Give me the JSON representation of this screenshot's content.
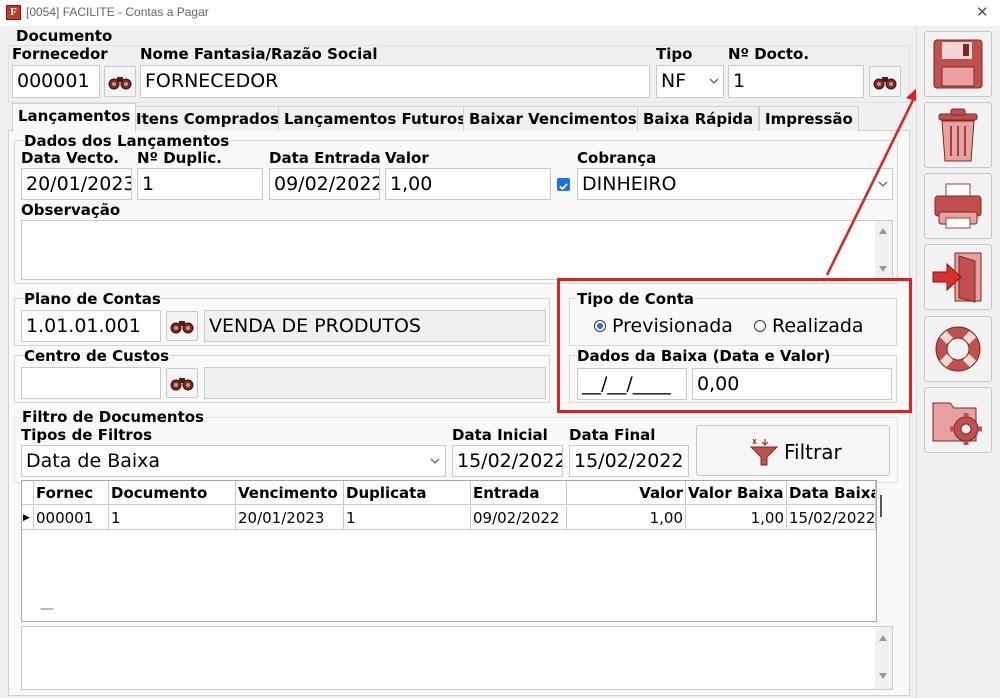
{
  "window": {
    "title": "[0054] FACILITE - Contas a Pagar",
    "app_icon_letter": "F",
    "close_glyph": "✕"
  },
  "header": {
    "section_title": "Documento",
    "fornecedor_label": "Fornecedor",
    "fornecedor_value": "000001",
    "nome_label": "Nome Fantasia/Razão Social",
    "nome_value": "FORNECEDOR",
    "tipo_label": "Tipo",
    "tipo_value": "NF",
    "ndocto_label": "Nº Docto.",
    "ndocto_value": "1"
  },
  "tabs": [
    {
      "label": "Lançamentos",
      "active": true
    },
    {
      "label": "Itens Comprados"
    },
    {
      "label": "Lançamentos Futuros"
    },
    {
      "label": "Baixar Vencimentos"
    },
    {
      "label": "Baixa Rápida"
    },
    {
      "label": "Impressão"
    }
  ],
  "dados": {
    "section_title": "Dados dos Lançamentos",
    "data_vecto_label": "Data Vecto.",
    "data_vecto_value": "20/01/2023",
    "n_duplic_label": "Nº Duplic.",
    "n_duplic_value": "1",
    "data_entrada_label": "Data Entrada",
    "data_entrada_value": "09/02/2022",
    "valor_label": "Valor",
    "valor_value": "1,00",
    "cobranca_label": "Cobrança",
    "cobranca_value": "DINHEIRO",
    "cobranca_checked": true,
    "observacao_label": "Observação"
  },
  "plano": {
    "label": "Plano de Contas",
    "code": "1.01.01.001",
    "description": "VENDA DE PRODUTOS"
  },
  "centro": {
    "label": "Centro de Custos",
    "code": "",
    "description": ""
  },
  "tipo_conta": {
    "label": "Tipo de Conta",
    "options": [
      {
        "label": "Previsionada",
        "selected": true
      },
      {
        "label": "Realizada",
        "selected": false
      }
    ]
  },
  "dados_baixa": {
    "label": "Dados da Baixa (Data e Valor)",
    "date_value": "__/__/____",
    "amount_value": "0,00"
  },
  "filtro": {
    "section_title": "Filtro de Documentos",
    "tipos_label": "Tipos de Filtros",
    "tipo_value": "Data de Baixa",
    "data_inicial_label": "Data Inicial",
    "data_inicial_value": "15/02/2022",
    "data_final_label": "Data Final",
    "data_final_value": "15/02/2022",
    "filtrar_label": "Filtrar"
  },
  "grid": {
    "columns": [
      "Fornec",
      "Documento",
      "Vencimento",
      "Duplicata",
      "Entrada",
      "Valor",
      "Valor Baixa",
      "Data Baixa"
    ],
    "rows": [
      [
        "000001",
        "1",
        "20/01/2023",
        "1",
        "09/02/2022",
        "1,00",
        "1,00",
        "15/02/2022"
      ]
    ],
    "row_pointer": "▶",
    "footer_mark": "—"
  },
  "toolbar": {
    "buttons": [
      {
        "name": "save",
        "icon": "floppy-disk-icon"
      },
      {
        "name": "delete",
        "icon": "trash-can-icon"
      },
      {
        "name": "print",
        "icon": "printer-icon"
      },
      {
        "name": "exit",
        "icon": "exit-door-icon"
      },
      {
        "name": "help",
        "icon": "lifebuoy-icon"
      },
      {
        "name": "settings",
        "icon": "folder-gear-icon"
      }
    ]
  },
  "annotation": {
    "color": "#e0201c"
  },
  "colors": {
    "accent": "#1a73e8",
    "icon_red": "#c0504d",
    "icon_pink": "#e8a0a0"
  }
}
